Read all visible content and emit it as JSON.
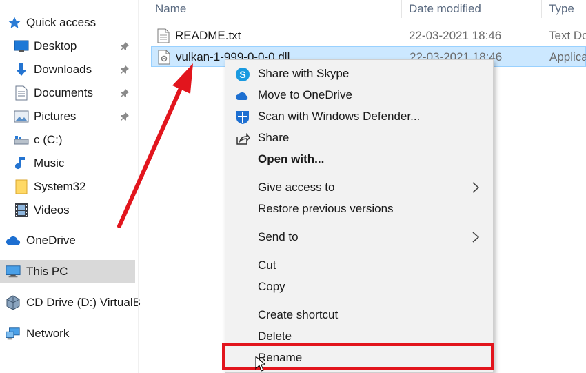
{
  "nav": {
    "items": [
      {
        "label": "Quick access",
        "icon": "star-icon"
      },
      {
        "label": "Desktop",
        "icon": "desktop-icon",
        "pinned": true
      },
      {
        "label": "Downloads",
        "icon": "download-arrow-icon",
        "pinned": true
      },
      {
        "label": "Documents",
        "icon": "documents-icon",
        "pinned": true
      },
      {
        "label": "Pictures",
        "icon": "pictures-icon",
        "pinned": true
      },
      {
        "label": "c (C:)",
        "icon": "drive-icon"
      },
      {
        "label": "Music",
        "icon": "music-note-icon"
      },
      {
        "label": "System32",
        "icon": "folder-icon"
      },
      {
        "label": "Videos",
        "icon": "film-icon"
      },
      {
        "label": "OneDrive",
        "icon": "cloud-icon"
      },
      {
        "label": "This PC",
        "icon": "computer-icon",
        "selected": true
      },
      {
        "label": "CD Drive (D:) VirtualB",
        "icon": "cd-drive-icon"
      },
      {
        "label": "Network",
        "icon": "network-icon"
      }
    ]
  },
  "list": {
    "columns": {
      "name": "Name",
      "date": "Date modified",
      "type": "Type"
    },
    "rows": [
      {
        "name": "README.txt",
        "date": "22-03-2021 18:46",
        "type": "Text Do",
        "icon": "text-file-icon",
        "selected": false
      },
      {
        "name": "vulkan-1-999-0-0-0.dll",
        "date": "22-03-2021 18:46",
        "type": "Applica",
        "icon": "dll-file-icon",
        "selected": true
      }
    ]
  },
  "context_menu": {
    "items": [
      {
        "label": "Share with Skype",
        "icon": "skype-icon"
      },
      {
        "label": "Move to OneDrive",
        "icon": "onedrive-cloud-icon"
      },
      {
        "label": "Scan with Windows Defender...",
        "icon": "defender-shield-icon"
      },
      {
        "label": "Share",
        "icon": "share-icon"
      },
      {
        "label": "Open with...",
        "bold": true
      },
      {
        "label": "Give access to",
        "submenu": true
      },
      {
        "label": "Restore previous versions"
      },
      {
        "label": "Send to",
        "submenu": true
      },
      {
        "label": "Cut"
      },
      {
        "label": "Copy"
      },
      {
        "label": "Create shortcut"
      },
      {
        "label": "Delete"
      },
      {
        "label": "Rename",
        "highlighted": true
      }
    ]
  },
  "colors": {
    "annotation": "#e2151d",
    "selection": "#cce8ff",
    "selection_border": "#99d1ff",
    "menu_bg": "#f2f2f2"
  }
}
